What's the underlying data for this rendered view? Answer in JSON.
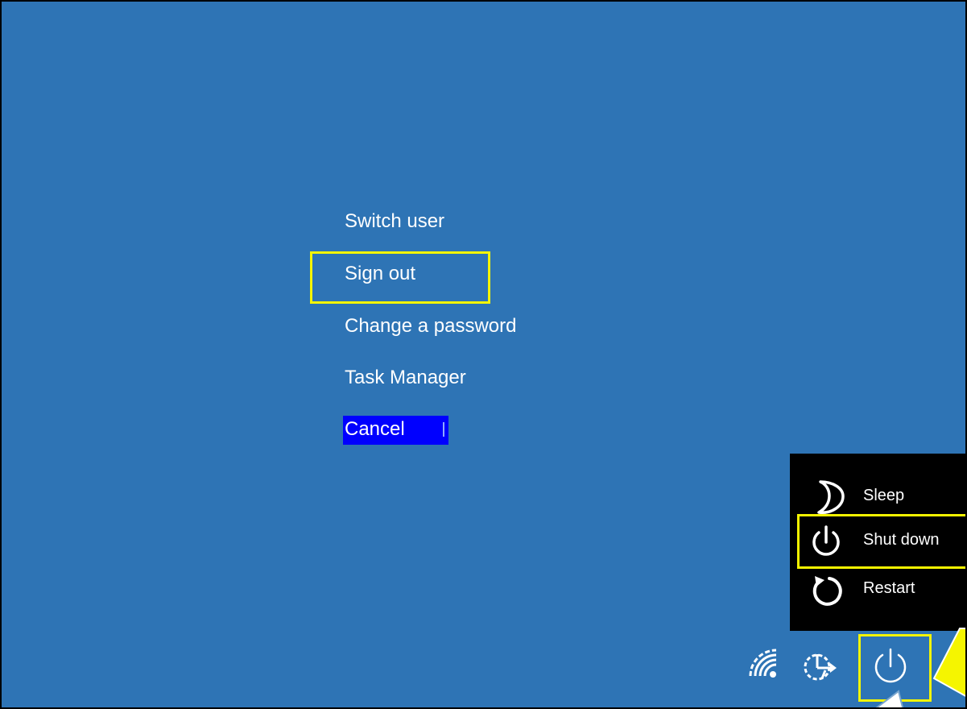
{
  "security_menu": {
    "items": [
      {
        "label": "Switch user"
      },
      {
        "label": "Sign out"
      },
      {
        "label": "Change a password"
      },
      {
        "label": "Task Manager"
      }
    ],
    "cancel_label": "Cancel"
  },
  "power_menu": {
    "items": [
      {
        "label": "Sleep",
        "icon": "sleep-icon"
      },
      {
        "label": "Shut down",
        "icon": "power-icon"
      },
      {
        "label": "Restart",
        "icon": "restart-icon"
      }
    ]
  },
  "tray": {
    "icons": [
      "wifi-icon",
      "ease-of-access-icon",
      "power-icon"
    ]
  },
  "colors": {
    "background": "#2e74b5",
    "highlight": "#f5f500",
    "cancel_bg": "#0000ff",
    "power_menu_bg": "#000000",
    "text": "#ffffff"
  }
}
